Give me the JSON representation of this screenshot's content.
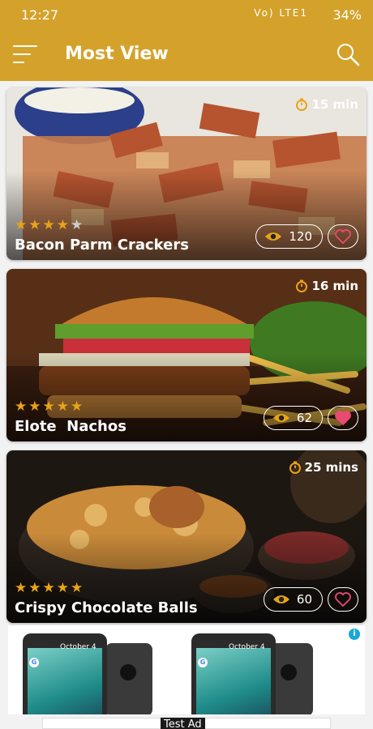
{
  "status_bar": {
    "time": "12:27",
    "signal_text": "Vo) LTE1",
    "battery": "34%"
  },
  "app_bar": {
    "title": "Most View"
  },
  "colors": {
    "accent": "#d4a22b",
    "star": "#e8a417",
    "heart_filled": "#e84a73"
  },
  "recipes": [
    {
      "title": "Bacon Parm Crackers",
      "time": "15 min",
      "rating": 4,
      "views": "120",
      "favorite": false
    },
    {
      "title": "Elote  Nachos",
      "time": "16 min",
      "rating": 5,
      "views": "62",
      "favorite": true
    },
    {
      "title": "Crispy Chocolate Balls",
      "time": "25 mins",
      "rating": 5,
      "views": "60",
      "favorite": false
    }
  ],
  "ad": {
    "info": "i",
    "phone_date_1": "October 4",
    "phone_date_2": "October 4",
    "g_letter": "G",
    "label": "Test Ad"
  }
}
